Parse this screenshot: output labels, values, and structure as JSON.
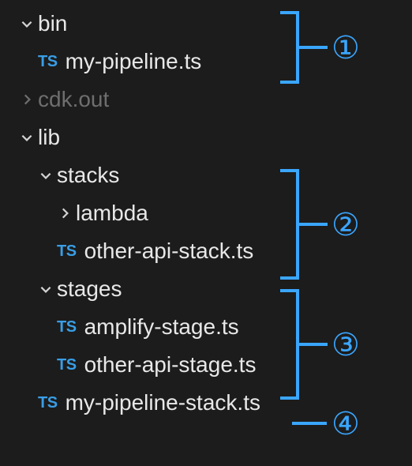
{
  "tree": {
    "bin": {
      "label": "bin",
      "expanded": true
    },
    "my_pipeline_ts": {
      "label": "my-pipeline.ts",
      "ext": "TS"
    },
    "cdk_out": {
      "label": "cdk.out",
      "expanded": false
    },
    "lib": {
      "label": "lib",
      "expanded": true
    },
    "stacks": {
      "label": "stacks",
      "expanded": true
    },
    "lambda": {
      "label": "lambda",
      "expanded": false
    },
    "other_api_stack": {
      "label": "other-api-stack.ts",
      "ext": "TS"
    },
    "stages": {
      "label": "stages",
      "expanded": true
    },
    "amplify_stage": {
      "label": "amplify-stage.ts",
      "ext": "TS"
    },
    "other_api_stage": {
      "label": "other-api-stage.ts",
      "ext": "TS"
    },
    "my_pipeline_stack": {
      "label": "my-pipeline-stack.ts",
      "ext": "TS"
    }
  },
  "annotations": {
    "c1": "①",
    "c2": "②",
    "c3": "③",
    "c4": "④"
  }
}
